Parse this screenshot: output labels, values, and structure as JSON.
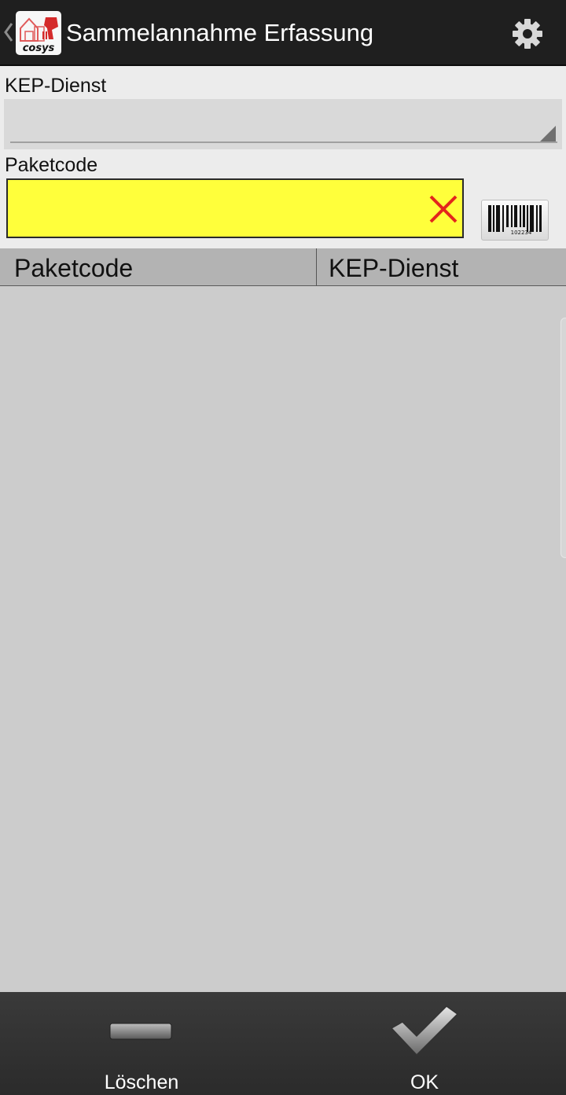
{
  "header": {
    "title": "Sammelannahme Erfassung",
    "logo_text": "cosys",
    "back_icon": "chevron-left-icon",
    "settings_icon": "gear-icon"
  },
  "form": {
    "kep_label": "KEP-Dienst",
    "kep_value": "",
    "paketcode_label": "Paketcode",
    "paketcode_value": "",
    "clear_icon": "close-icon",
    "scan_icon": "barcode-icon",
    "barcode_number": "102234",
    "input_color": "#ffff3b"
  },
  "table": {
    "columns": [
      "Paketcode",
      "KEP-Dienst"
    ],
    "rows": []
  },
  "bottom": {
    "delete_label": "Löschen",
    "ok_label": "OK"
  }
}
